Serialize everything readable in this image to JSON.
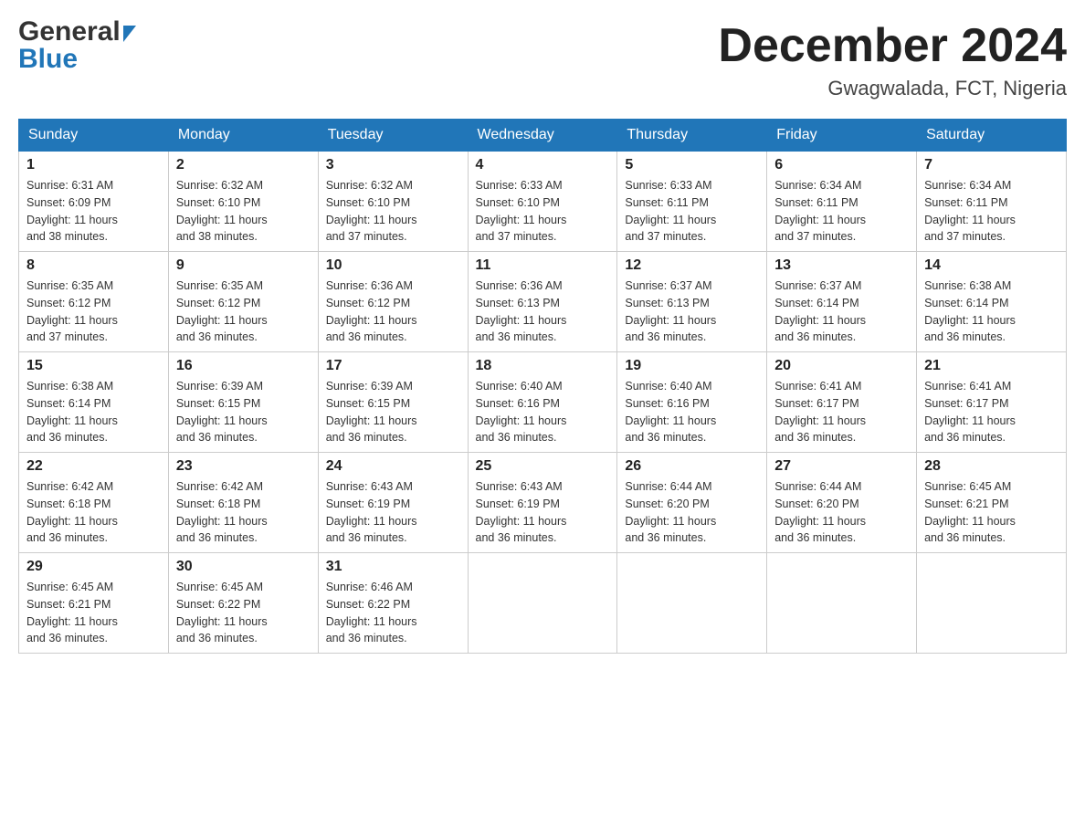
{
  "logo": {
    "general": "General",
    "blue": "Blue",
    "arrow": "▶"
  },
  "title": "December 2024",
  "location": "Gwagwalada, FCT, Nigeria",
  "days": [
    "Sunday",
    "Monday",
    "Tuesday",
    "Wednesday",
    "Thursday",
    "Friday",
    "Saturday"
  ],
  "weeks": [
    [
      {
        "num": "1",
        "sunrise": "6:31 AM",
        "sunset": "6:09 PM",
        "daylight": "11 hours and 38 minutes."
      },
      {
        "num": "2",
        "sunrise": "6:32 AM",
        "sunset": "6:10 PM",
        "daylight": "11 hours and 38 minutes."
      },
      {
        "num": "3",
        "sunrise": "6:32 AM",
        "sunset": "6:10 PM",
        "daylight": "11 hours and 37 minutes."
      },
      {
        "num": "4",
        "sunrise": "6:33 AM",
        "sunset": "6:10 PM",
        "daylight": "11 hours and 37 minutes."
      },
      {
        "num": "5",
        "sunrise": "6:33 AM",
        "sunset": "6:11 PM",
        "daylight": "11 hours and 37 minutes."
      },
      {
        "num": "6",
        "sunrise": "6:34 AM",
        "sunset": "6:11 PM",
        "daylight": "11 hours and 37 minutes."
      },
      {
        "num": "7",
        "sunrise": "6:34 AM",
        "sunset": "6:11 PM",
        "daylight": "11 hours and 37 minutes."
      }
    ],
    [
      {
        "num": "8",
        "sunrise": "6:35 AM",
        "sunset": "6:12 PM",
        "daylight": "11 hours and 37 minutes."
      },
      {
        "num": "9",
        "sunrise": "6:35 AM",
        "sunset": "6:12 PM",
        "daylight": "11 hours and 36 minutes."
      },
      {
        "num": "10",
        "sunrise": "6:36 AM",
        "sunset": "6:12 PM",
        "daylight": "11 hours and 36 minutes."
      },
      {
        "num": "11",
        "sunrise": "6:36 AM",
        "sunset": "6:13 PM",
        "daylight": "11 hours and 36 minutes."
      },
      {
        "num": "12",
        "sunrise": "6:37 AM",
        "sunset": "6:13 PM",
        "daylight": "11 hours and 36 minutes."
      },
      {
        "num": "13",
        "sunrise": "6:37 AM",
        "sunset": "6:14 PM",
        "daylight": "11 hours and 36 minutes."
      },
      {
        "num": "14",
        "sunrise": "6:38 AM",
        "sunset": "6:14 PM",
        "daylight": "11 hours and 36 minutes."
      }
    ],
    [
      {
        "num": "15",
        "sunrise": "6:38 AM",
        "sunset": "6:14 PM",
        "daylight": "11 hours and 36 minutes."
      },
      {
        "num": "16",
        "sunrise": "6:39 AM",
        "sunset": "6:15 PM",
        "daylight": "11 hours and 36 minutes."
      },
      {
        "num": "17",
        "sunrise": "6:39 AM",
        "sunset": "6:15 PM",
        "daylight": "11 hours and 36 minutes."
      },
      {
        "num": "18",
        "sunrise": "6:40 AM",
        "sunset": "6:16 PM",
        "daylight": "11 hours and 36 minutes."
      },
      {
        "num": "19",
        "sunrise": "6:40 AM",
        "sunset": "6:16 PM",
        "daylight": "11 hours and 36 minutes."
      },
      {
        "num": "20",
        "sunrise": "6:41 AM",
        "sunset": "6:17 PM",
        "daylight": "11 hours and 36 minutes."
      },
      {
        "num": "21",
        "sunrise": "6:41 AM",
        "sunset": "6:17 PM",
        "daylight": "11 hours and 36 minutes."
      }
    ],
    [
      {
        "num": "22",
        "sunrise": "6:42 AM",
        "sunset": "6:18 PM",
        "daylight": "11 hours and 36 minutes."
      },
      {
        "num": "23",
        "sunrise": "6:42 AM",
        "sunset": "6:18 PM",
        "daylight": "11 hours and 36 minutes."
      },
      {
        "num": "24",
        "sunrise": "6:43 AM",
        "sunset": "6:19 PM",
        "daylight": "11 hours and 36 minutes."
      },
      {
        "num": "25",
        "sunrise": "6:43 AM",
        "sunset": "6:19 PM",
        "daylight": "11 hours and 36 minutes."
      },
      {
        "num": "26",
        "sunrise": "6:44 AM",
        "sunset": "6:20 PM",
        "daylight": "11 hours and 36 minutes."
      },
      {
        "num": "27",
        "sunrise": "6:44 AM",
        "sunset": "6:20 PM",
        "daylight": "11 hours and 36 minutes."
      },
      {
        "num": "28",
        "sunrise": "6:45 AM",
        "sunset": "6:21 PM",
        "daylight": "11 hours and 36 minutes."
      }
    ],
    [
      {
        "num": "29",
        "sunrise": "6:45 AM",
        "sunset": "6:21 PM",
        "daylight": "11 hours and 36 minutes."
      },
      {
        "num": "30",
        "sunrise": "6:45 AM",
        "sunset": "6:22 PM",
        "daylight": "11 hours and 36 minutes."
      },
      {
        "num": "31",
        "sunrise": "6:46 AM",
        "sunset": "6:22 PM",
        "daylight": "11 hours and 36 minutes."
      },
      null,
      null,
      null,
      null
    ]
  ],
  "sunrise_label": "Sunrise:",
  "sunset_label": "Sunset:",
  "daylight_label": "Daylight:"
}
